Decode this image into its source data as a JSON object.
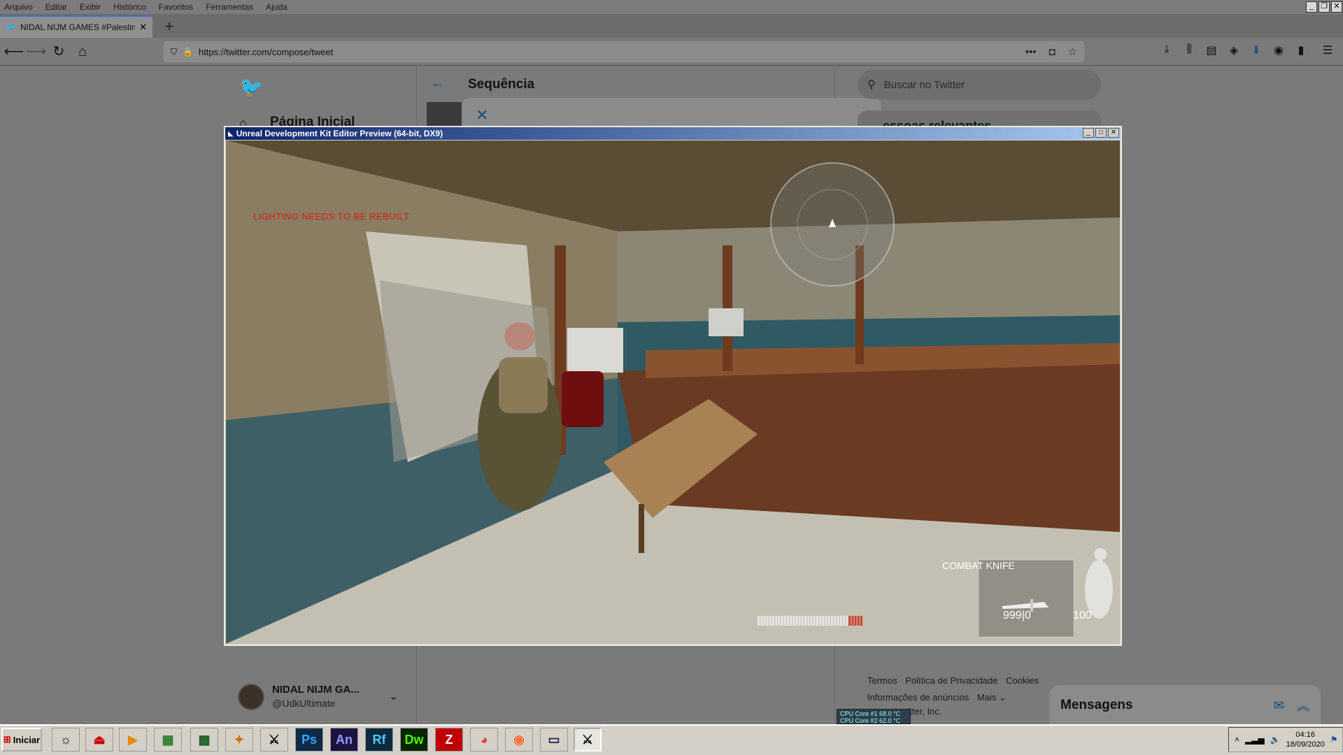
{
  "browser": {
    "menu": [
      "Arquivo",
      "Editar",
      "Exibir",
      "Histórico",
      "Favoritos",
      "Ferramentas",
      "Ajuda"
    ],
    "tab_title": "NIDAL NIJM GAMES #PalestineWill",
    "new_tab": "+",
    "url": "https://twitter.com/compose/tweet",
    "url_actions": "•••",
    "win_controls": [
      "_",
      "❐",
      "✕"
    ]
  },
  "twitter": {
    "nav_home": "Página Inicial",
    "thread_title": "Sequência",
    "search_placeholder": "Buscar no Twitter",
    "relevant_people": "essoas relevantes",
    "user_name": "NIDAL NIJM GA...",
    "user_handle": "@UdkUltimate",
    "footer": {
      "terms": "Termos",
      "privacy": "Política de Privacidade",
      "cookies": "Cookies",
      "ads": "Informações de anúncios",
      "more": "Mais ⌄",
      "inc": "witter, Inc."
    },
    "messages": "Mensagens"
  },
  "udk": {
    "title": "Unreal Development Kit Editor Preview (64-bit, DX9)",
    "win_controls": [
      "_",
      "□",
      "✕"
    ],
    "lighting_msg": "LIGHTING NEEDS TO BE REBUILT",
    "weapon": "COMBAT KNIFE",
    "ammo": "999|0",
    "health": "100",
    "ammo_fill": 0.85
  },
  "cpu": {
    "line1": "CPU Core #1   68.0 °C",
    "line2": "CPU Core #2   62.0 °C"
  },
  "taskbar": {
    "start": "Iniciar",
    "apps": [
      "Ps",
      "An",
      "Rf",
      "Dw"
    ],
    "time": "04:16",
    "date": "18/09/2020"
  }
}
